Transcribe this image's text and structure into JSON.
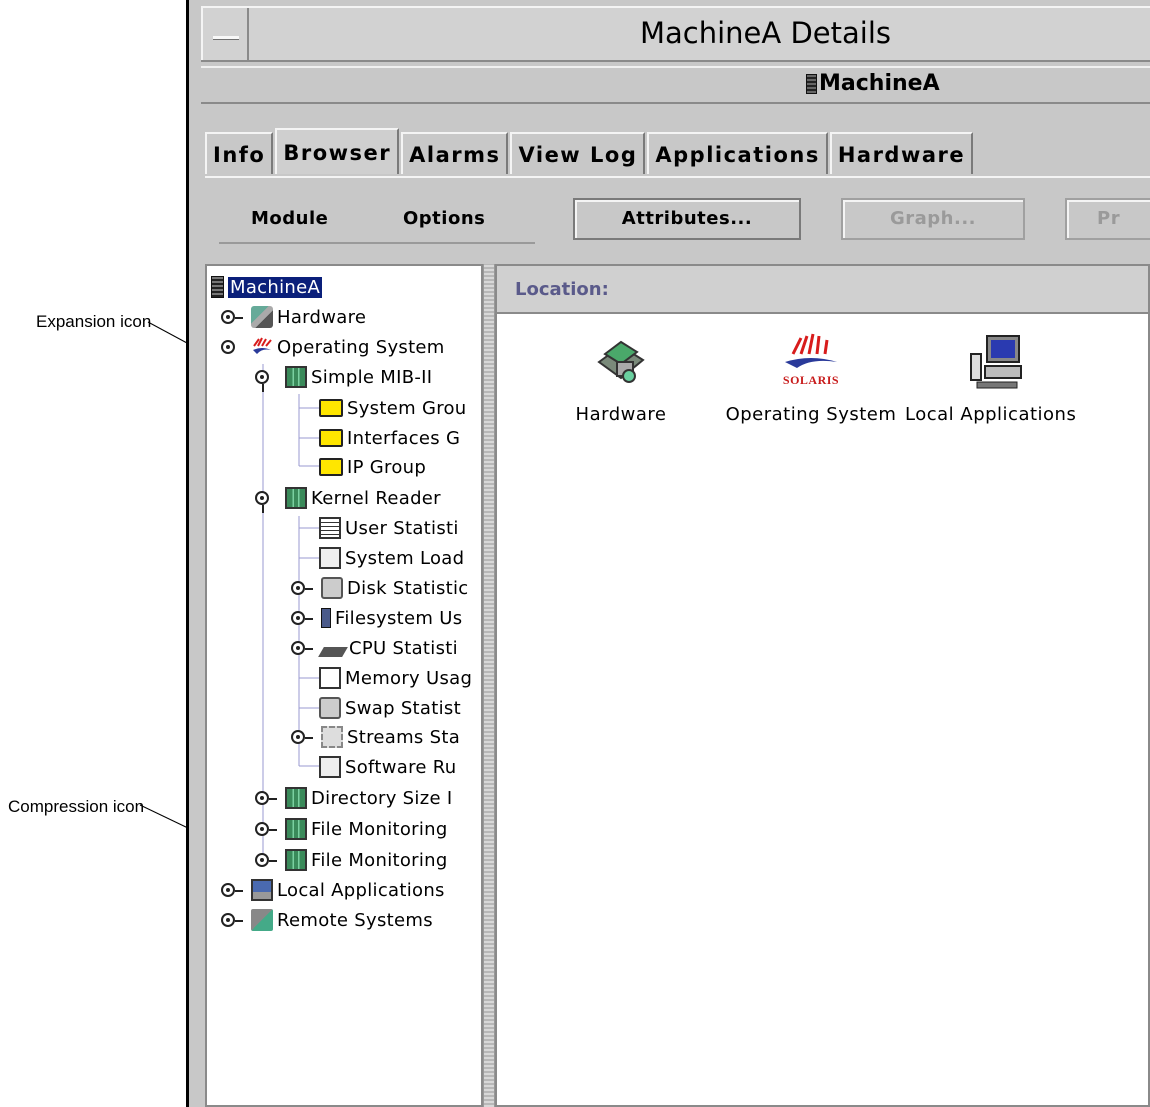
{
  "window": {
    "title": "MachineA Details",
    "host_label": "MachineA"
  },
  "tabs": [
    {
      "label": "Info"
    },
    {
      "label": "Browser"
    },
    {
      "label": "Alarms"
    },
    {
      "label": "View Log"
    },
    {
      "label": "Applications"
    },
    {
      "label": "Hardware"
    }
  ],
  "active_tab": "Browser",
  "menus": [
    {
      "label": "Module"
    },
    {
      "label": "Options"
    }
  ],
  "buttons": {
    "attributes": "Attributes...",
    "graph": "Graph...",
    "partial": "Pr"
  },
  "location": {
    "label": "Location:"
  },
  "tree": [
    {
      "label": "MachineA",
      "icon": "server-icon",
      "selected": true
    },
    {
      "label": "Hardware",
      "icon": "hardware-icon"
    },
    {
      "label": "Operating System",
      "icon": "solaris-icon"
    },
    {
      "label": "Simple MIB-II",
      "icon": "module-icon"
    },
    {
      "label": "System Grou",
      "icon": "folder-icon"
    },
    {
      "label": "Interfaces G",
      "icon": "folder-icon"
    },
    {
      "label": "IP Group",
      "icon": "folder-icon"
    },
    {
      "label": "Kernel Reader",
      "icon": "module-icon"
    },
    {
      "label": "User Statisti",
      "icon": "document-icon"
    },
    {
      "label": "System Load",
      "icon": "graph-icon"
    },
    {
      "label": "Disk Statistic",
      "icon": "disk-icon"
    },
    {
      "label": "Filesystem Us",
      "icon": "filesystem-icon"
    },
    {
      "label": "CPU Statisti",
      "icon": "cpu-icon"
    },
    {
      "label": "Memory Usag",
      "icon": "memory-icon"
    },
    {
      "label": "Swap Statist",
      "icon": "disk-icon"
    },
    {
      "label": "Streams Sta",
      "icon": "chip-icon"
    },
    {
      "label": "Software Ru",
      "icon": "graph-icon"
    },
    {
      "label": "Directory Size I",
      "icon": "module-icon"
    },
    {
      "label": "File Monitoring",
      "icon": "module-icon"
    },
    {
      "label": "File Monitoring",
      "icon": "module-icon"
    },
    {
      "label": "Local Applications",
      "icon": "computer-icon"
    },
    {
      "label": "Remote Systems",
      "icon": "remote-systems-icon"
    }
  ],
  "content_icons": [
    {
      "label": "Hardware",
      "icon": "hardware-icon"
    },
    {
      "label": "Operating System",
      "icon": "solaris-icon",
      "logo_text": "SOLARIS"
    },
    {
      "label": "Local Applications",
      "icon": "computer-icon"
    }
  ],
  "annotations": {
    "expansion": "Expansion icon",
    "compression": "Compression icon"
  }
}
